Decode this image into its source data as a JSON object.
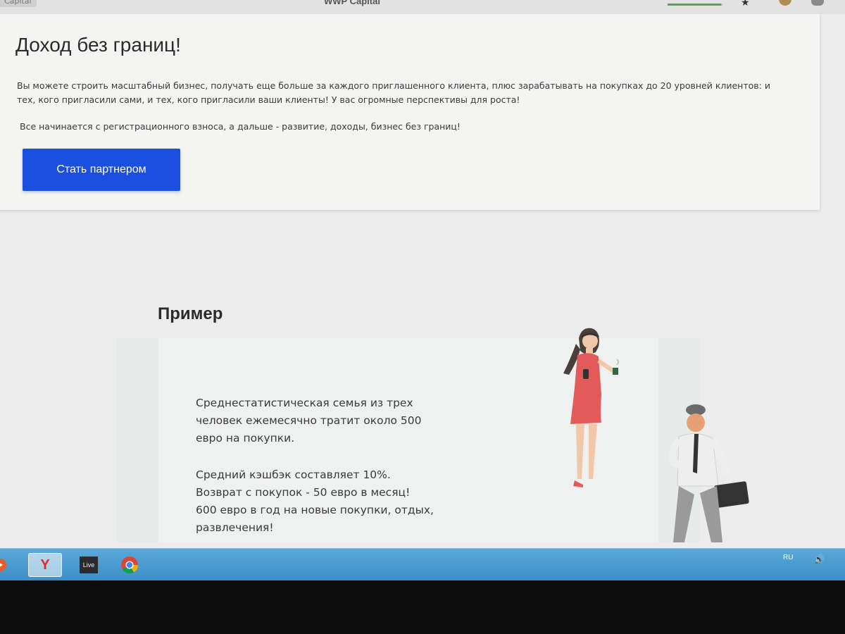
{
  "browser": {
    "tab_fragment": "Capital",
    "window_title": "WWP Capital",
    "progress": 0.97
  },
  "promo": {
    "title": "Доход без границ!",
    "text": "Вы можете строить масштабный бизнес, получать еще больше за каждого приглашенного клиента, плюс зарабатывать на покупках до 20 уровней клиентов: и тех, кого пригласили сами, и тех, кого пригласили ваши клиенты! У вас огромные перспективы для роста!",
    "text2": "Все начинается с регистрационного взноса, а дальше - развитие, доходы, бизнес без границ!",
    "button_label": "Стать партнером",
    "accent_color": "#1a4fe0"
  },
  "example": {
    "title": "Пример",
    "paragraph1": "Среднестатистическая семья из трех человек ежемесячно тратит около 500 евро на покупки.",
    "paragraph2_line1": "Средний кэшбэк составляет 10%.",
    "paragraph2_line2": "Возврат с покупок -  50 евро в месяц!",
    "paragraph2_line3": "600 евро в год на новые покупки, отдых, развлечения!"
  },
  "taskbar": {
    "items": [
      {
        "name": "media-player-icon"
      },
      {
        "name": "yandex-browser-icon",
        "glyph": "Y"
      },
      {
        "name": "live-app-icon",
        "label": "Live"
      },
      {
        "name": "chrome-icon"
      }
    ],
    "language": "RU"
  }
}
